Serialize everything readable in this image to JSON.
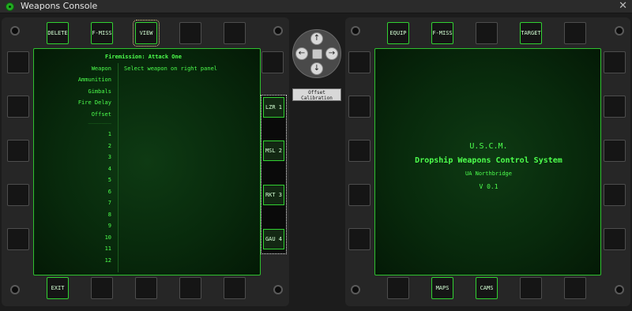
{
  "window": {
    "title": "Weapons Console",
    "close_glyph": "✕"
  },
  "left": {
    "top_buttons": [
      "DELETE",
      "F-MISS",
      "VIEW",
      "",
      ""
    ],
    "bottom_buttons": [
      "EXIT",
      "",
      "",
      "",
      ""
    ],
    "screen": {
      "title": "Firemission: Attack One",
      "fields": [
        "Weapon",
        "Ammunition",
        "Gimbals",
        "Fire Delay",
        "Offset"
      ],
      "hint": "Select weapon on right panel",
      "separator": "_______",
      "rows": [
        "1",
        "2",
        "3",
        "4",
        "5",
        "6",
        "7",
        "8",
        "9",
        "10",
        "11",
        "12"
      ]
    },
    "weapon_strip": [
      "LZR 1",
      "MSL 2",
      "RKT 3",
      "GAU 4"
    ]
  },
  "center": {
    "dpad": {
      "up": "↑",
      "down": "↓",
      "left": "←",
      "right": "→"
    },
    "offset_calibration": "Offset Calibration"
  },
  "right": {
    "top_buttons": [
      "EQUIP",
      "F-MISS",
      "",
      "TARGET"
    ],
    "bottom_buttons": [
      "",
      "MAPS",
      "CAMS",
      ""
    ],
    "screen": {
      "line1": "U.S.C.M.",
      "line2": "Dropship Weapons Control System",
      "line3": "UA Northbridge",
      "line4": "V 0.1"
    }
  },
  "colors": {
    "screen_text": "#4dff4d",
    "button_border_active": "#31d131",
    "panel": "#262626"
  }
}
